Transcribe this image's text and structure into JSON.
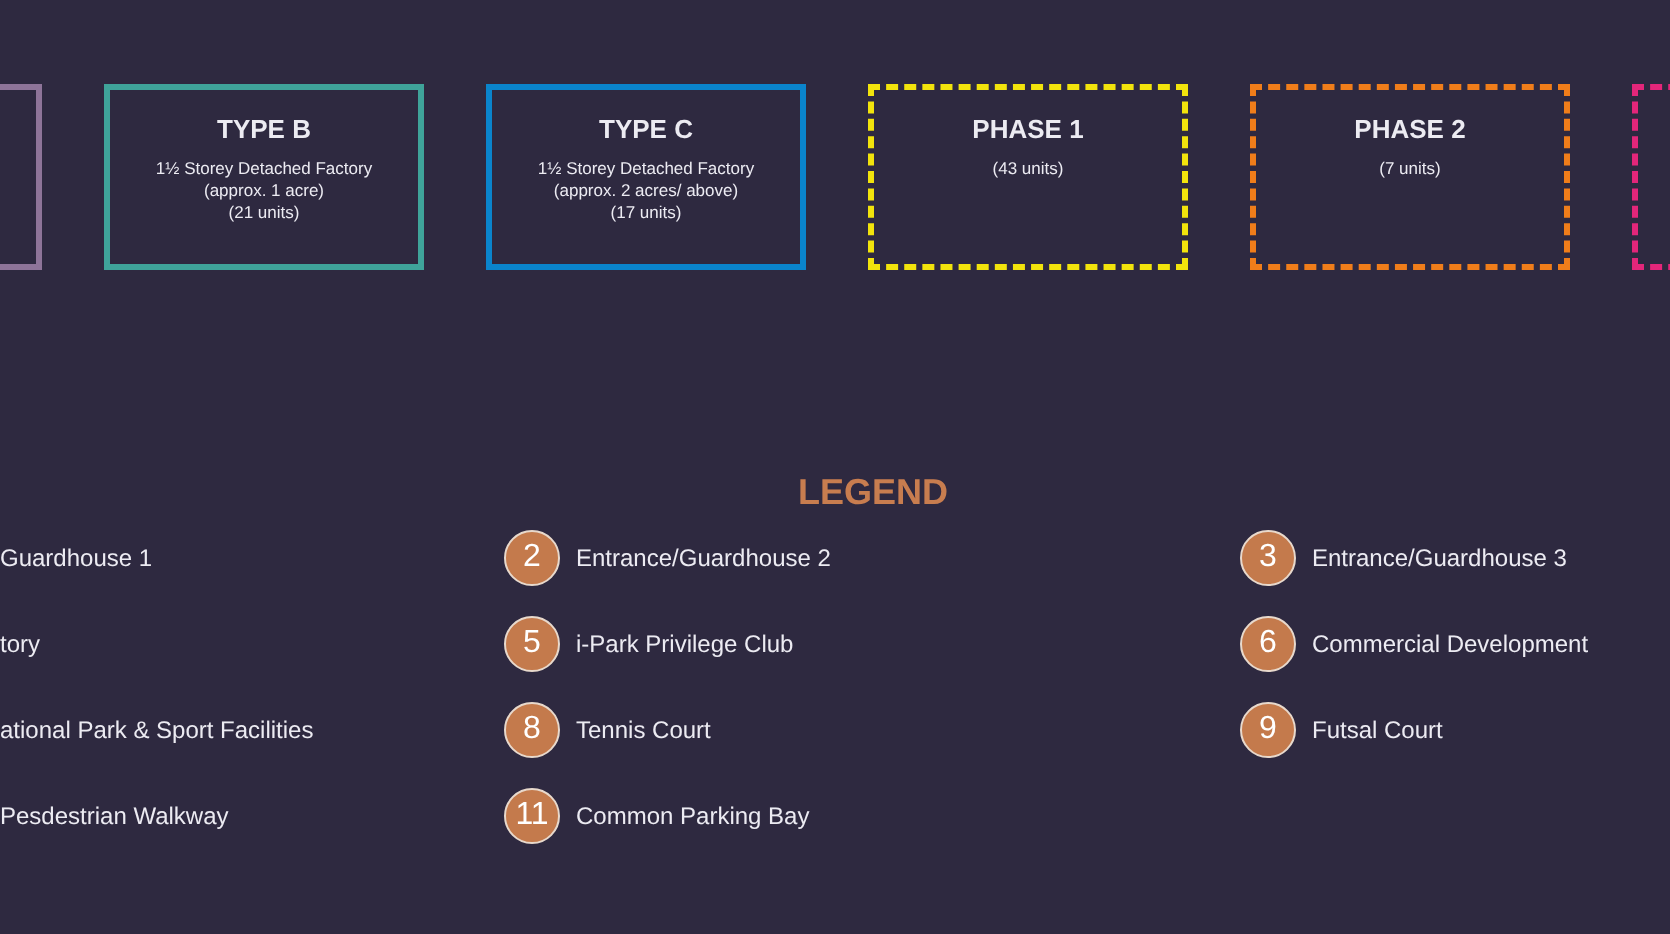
{
  "cards": [
    {
      "kind": "solid",
      "color": "#8e7499"
    },
    {
      "kind": "solid",
      "color": "#3fa39a",
      "title": "TYPE B",
      "lines": [
        "1½ Storey Detached Factory",
        "(approx. 1 acre)",
        "(21 units)"
      ]
    },
    {
      "kind": "solid",
      "color": "#0a84cc",
      "title": "TYPE C",
      "lines": [
        "1½ Storey Detached Factory",
        "(approx. 2 acres/ above)",
        "(17 units)"
      ]
    },
    {
      "kind": "dashed",
      "color": "#f2e30c",
      "title": "PHASE 1",
      "lines": [
        "(43 units)"
      ]
    },
    {
      "kind": "dashed",
      "color": "#f07d1a",
      "title": "PHASE 2",
      "lines": [
        "(7 units)"
      ]
    },
    {
      "kind": "dashed",
      "color": "#e3267a"
    }
  ],
  "legend": {
    "title": "LEGEND",
    "items": [
      {
        "label": "Guardhouse 1"
      },
      {
        "number": "2",
        "label": "Entrance/Guardhouse 2"
      },
      {
        "number": "3",
        "label": "Entrance/Guardhouse 3"
      },
      {
        "label": "tory"
      },
      {
        "number": "5",
        "label": "i-Park Privilege Club"
      },
      {
        "number": "6",
        "label": "Commercial Development"
      },
      {
        "label": "ational Park & Sport Facilities"
      },
      {
        "number": "8",
        "label": "Tennis Court"
      },
      {
        "number": "9",
        "label": "Futsal Court"
      },
      {
        "label": "Pesdestrian Walkway"
      },
      {
        "number": "11",
        "label": "Common Parking Bay"
      }
    ]
  }
}
